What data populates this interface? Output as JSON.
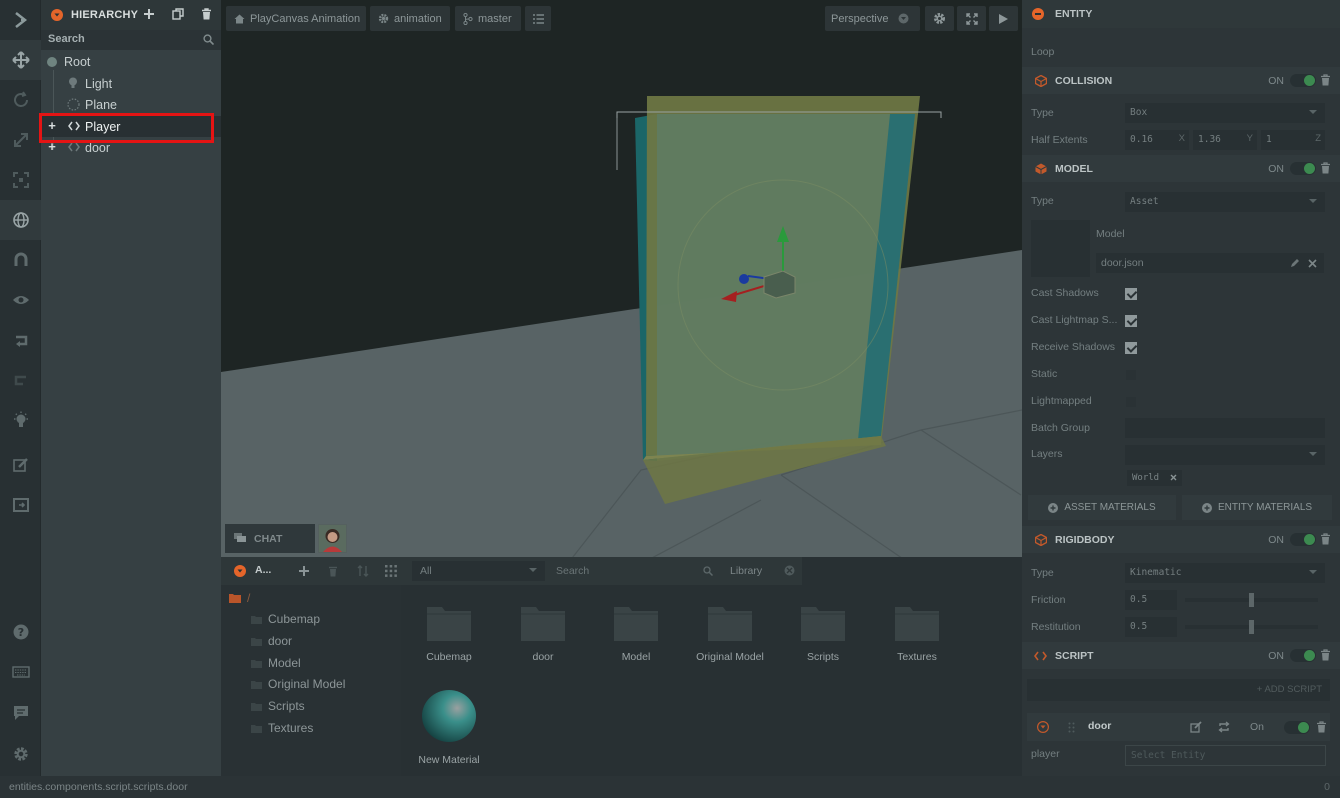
{
  "colors": {
    "accent": "#e5652a",
    "toggle_on": "#3c8a50",
    "highlight": "#e51414"
  },
  "toolbar": {
    "icons": [
      "playcanvas-logo-icon",
      "translate-icon",
      "rotate-icon",
      "scale-icon",
      "resize-icon",
      "world-icon",
      "magnet-icon",
      "eye-icon",
      "undo-icon",
      "redo-icon",
      "lightbulb-icon",
      "edit-icon",
      "publish-icon",
      "help-icon",
      "keyboard-icon",
      "chat-icon",
      "settings-icon"
    ]
  },
  "hierarchy": {
    "title": "HIERARCHY",
    "search_placeholder": "Search",
    "items": [
      {
        "label": "Root"
      },
      {
        "label": "Light"
      },
      {
        "label": "Plane"
      },
      {
        "label": "Player"
      },
      {
        "label": "door"
      }
    ]
  },
  "viewport": {
    "project": "PlayCanvas Animation",
    "scene": "animation",
    "branch": "master",
    "camera": "Perspective"
  },
  "chat": {
    "label": "CHAT"
  },
  "assets": {
    "title": "A...",
    "filter": "All",
    "search_placeholder": "Search",
    "library": "Library",
    "root": "/",
    "folders": [
      "Cubemap",
      "door",
      "Model",
      "Original Model",
      "Scripts",
      "Textures"
    ],
    "tiles": [
      "Cubemap",
      "door",
      "Model",
      "Original Model",
      "Scripts",
      "Textures"
    ],
    "material": "New Material"
  },
  "inspector": {
    "entity": "ENTITY",
    "loop_label": "Loop",
    "collision": {
      "title": "COLLISION",
      "on": "ON",
      "type_label": "Type",
      "type": "Box",
      "half_label": "Half Extents",
      "x": "0.16",
      "x_axis": "X",
      "y": "1.36",
      "y_axis": "Y",
      "z": "1",
      "z_axis": "Z"
    },
    "model": {
      "title": "MODEL",
      "on": "ON",
      "type_label": "Type",
      "type": "Asset",
      "model_label": "Model",
      "model_asset": "door.json",
      "cast_shadows": "Cast Shadows",
      "cast_lightmap": "Cast Lightmap S...",
      "receive_shadows": "Receive Shadows",
      "static": "Static",
      "lightmapped": "Lightmapped",
      "batch_group": "Batch Group",
      "layers": "Layers",
      "layer_tag": "World",
      "asset_materials": "ASSET MATERIALS",
      "entity_materials": "ENTITY MATERIALS"
    },
    "rigidbody": {
      "title": "RIGIDBODY",
      "on": "ON",
      "type_label": "Type",
      "type": "Kinematic",
      "friction_label": "Friction",
      "friction": "0.5",
      "restitution_label": "Restitution",
      "restitution": "0.5",
      "friction_level": 0.5,
      "restitution_level": 0.5
    },
    "script": {
      "title": "SCRIPT",
      "on": "ON",
      "add_script": "+ ADD SCRIPT",
      "script_name": "door",
      "script_on": "On",
      "attr_label": "player",
      "attr_placeholder": "Select Entity"
    }
  },
  "status": {
    "path": "entities.components.script.scripts.door",
    "count": "0"
  }
}
